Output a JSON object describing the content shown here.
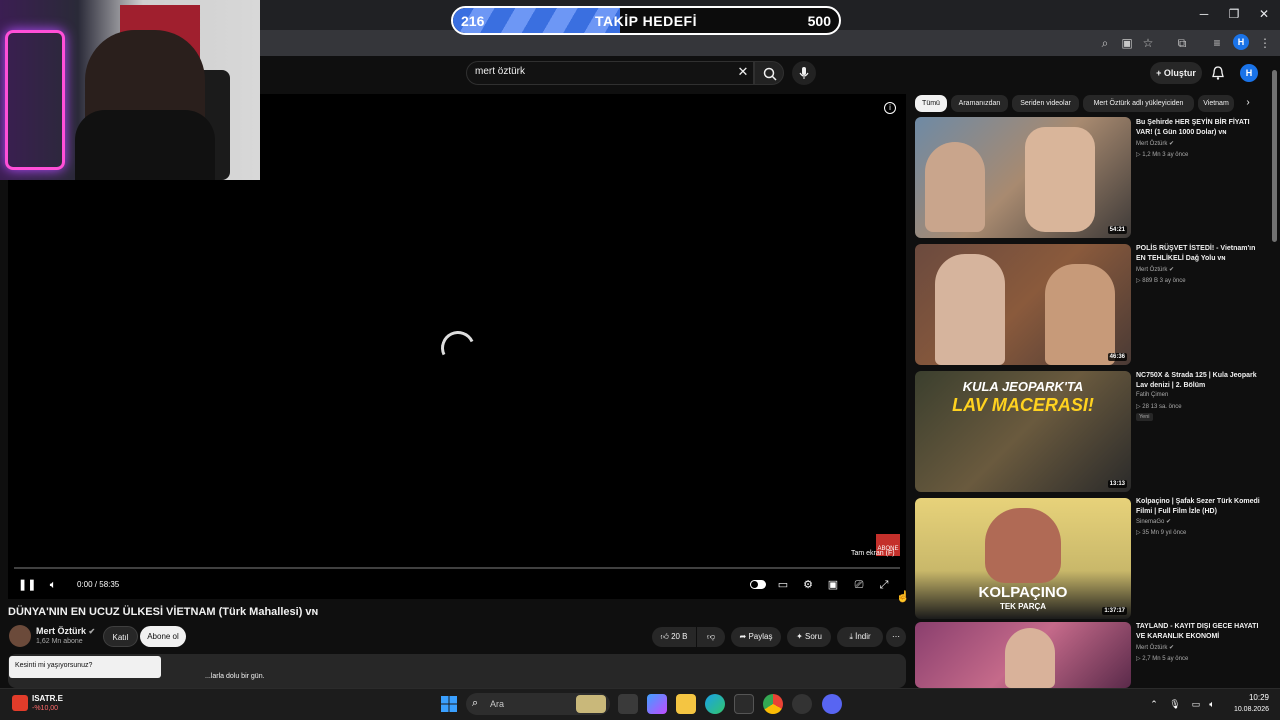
{
  "goal": {
    "current": "216",
    "title": "TAKİP HEDEFİ",
    "target": "500",
    "fill_fraction": 0.432
  },
  "browser": {
    "profile_initial": "H"
  },
  "header": {
    "search_value": "mert öztürk",
    "create_label": "Oluştur",
    "avatar_initial": "H"
  },
  "player": {
    "time": "0:00 / 58:35",
    "watermark_label": "ABONE",
    "fullscreen_tooltip": "Tam ekran (F)"
  },
  "video": {
    "title": "DÜNYA'NIN EN UCUZ ÜLKESİ VİETNAM (Türk Mahallesi) ᴠɴ",
    "channel": "Mert Öztürk",
    "subscribers": "1,62 Mn abone",
    "join_label": "Katıl",
    "subscribe_label": "Abone ol",
    "likes": "20 B",
    "share_label": "Paylaş",
    "ask_label": "Soru",
    "download_label": "İndir",
    "description_snippet": "...larla dolu bir gün."
  },
  "toast": {
    "text": "Kesinti mi yaşıyorsunuz?"
  },
  "chips": [
    "Tümü",
    "Aramanızdan",
    "Seriden videolar",
    "Mert Öztürk adlı yükleyiciden",
    "Vietnam"
  ],
  "related": [
    {
      "title": "Bu Şehirde HER ŞEYİN BİR FİYATI VAR! (1 Gün 1000 Dolar) ᴠɴ",
      "channel": "Mert Öztürk",
      "meta": "▷ 1,2 Mn  3 ay önce",
      "duration": "54:21",
      "badge": ""
    },
    {
      "title": "POLİS RÜŞVET İSTEDİ! - Vietnam'ın EN TEHLİKELİ Dağ Yolu ᴠɴ",
      "channel": "Mert Öztürk",
      "meta": "▷ 889 B  3 ay önce",
      "duration": "46:36",
      "badge": ""
    },
    {
      "title": "NC750X & Strada 125 | Kula Jeopark Lav denizi | 2. Bölüm",
      "channel": "Fatih Çimen",
      "meta": "▷ 28  13 sa. önce",
      "duration": "13:13",
      "badge": "Yeni"
    },
    {
      "title": "Kolpaçino | Şafak Sezer Türk Komedi Filmi | Full Film İzle (HD)",
      "channel": "SinemaGo",
      "meta": "▷ 35 Mn  9 yıl önce",
      "duration": "1:37:17",
      "badge": ""
    },
    {
      "title": "TAYLAND - KAYIT DIŞI GECE HAYATI VE KARANLIK EKONOMİ",
      "channel": "Mert Öztürk",
      "meta": "▷ 2,7 Mn  5 ay önce",
      "duration": "",
      "badge": ""
    }
  ],
  "thumb_overlays": {
    "lav_title": "KULA JEOPARK'TA",
    "lav_sub": "LAV MACERASI!",
    "kolpacino": "KOLPAÇINO",
    "kolpacino_sub": "TEK PARÇA"
  },
  "taskbar": {
    "stock_name": "ISATR.E",
    "stock_change": "-%10,00",
    "search_label": "Ara",
    "time": "10:29",
    "date": "10.08.2026"
  },
  "colors": {
    "goal_fill": "#3a6fe0",
    "yt_bg": "#0f0f0f",
    "accent_red": "#c4302b"
  }
}
